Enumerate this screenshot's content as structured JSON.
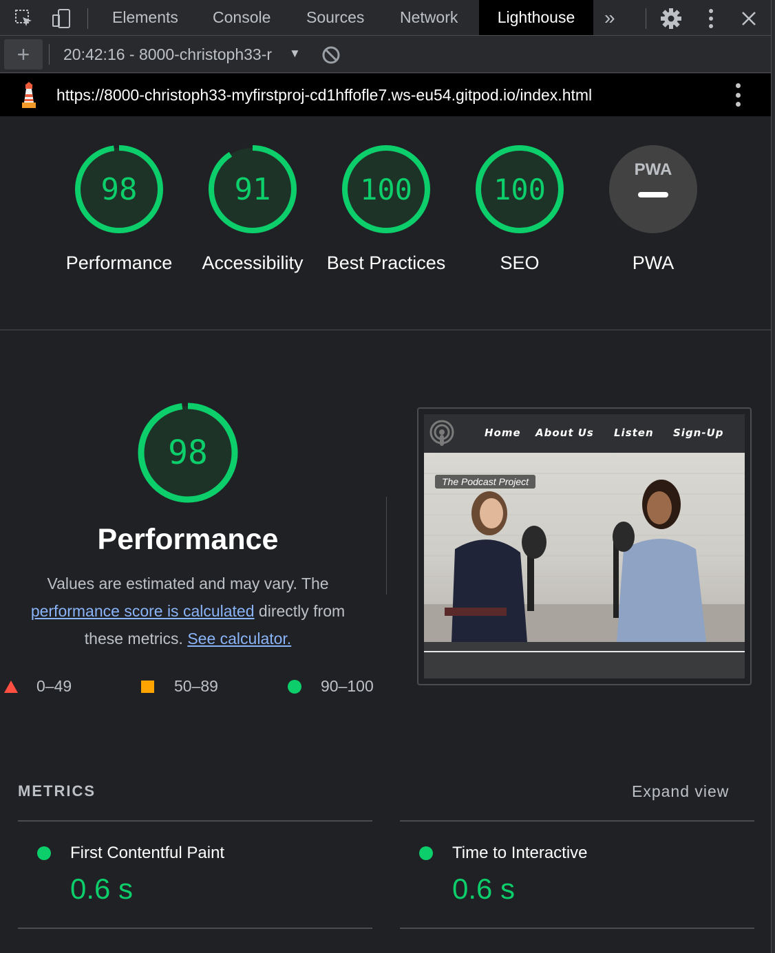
{
  "devtools": {
    "tabs": [
      "Elements",
      "Console",
      "Sources",
      "Network",
      "Lighthouse"
    ],
    "active_tab": "Lighthouse",
    "more_tabs_glyph": "»"
  },
  "toolbar": {
    "add_glyph": "+",
    "report_label": "20:42:16 - 8000-christoph33-r",
    "caret_glyph": "▼"
  },
  "url_bar": {
    "url": "https://8000-christoph33-myfirstproj-cd1hffofle7.ws-eu54.gitpod.io/index.html"
  },
  "gauges": [
    {
      "score": "98",
      "label": "Performance",
      "value": 0.98
    },
    {
      "score": "91",
      "label": "Accessibility",
      "value": 0.91
    },
    {
      "score": "100",
      "label": "Best Practices",
      "value": 1.0
    },
    {
      "score": "100",
      "label": "SEO",
      "value": 1.0
    },
    {
      "score": "PWA",
      "label": "PWA",
      "value": null
    }
  ],
  "performance": {
    "score": "98",
    "value": 0.98,
    "title": "Performance",
    "desc_1": "Values are estimated and may vary. The ",
    "link_1": "performance score is calculated",
    "desc_2": " directly from these metrics. ",
    "link_2": "See calculator.",
    "legend": [
      {
        "range": "0–49",
        "color": "#ff4e42",
        "shape": "triangle"
      },
      {
        "range": "50–89",
        "color": "#ffa400",
        "shape": "square"
      },
      {
        "range": "90–100",
        "color": "#0cce6b",
        "shape": "circle"
      }
    ]
  },
  "screenshot": {
    "nav_items": [
      "Home",
      "About Us",
      "Listen",
      "Sign-Up"
    ],
    "hero_tag": "The Podcast Project"
  },
  "metrics": {
    "heading": "METRICS",
    "expand_label": "Expand view",
    "items": [
      {
        "name": "First Contentful Paint",
        "value": "0.6 s"
      },
      {
        "name": "Time to Interactive",
        "value": "0.6 s"
      }
    ]
  },
  "colors": {
    "pass": "#0cce6b",
    "pass_text": "#0cce6b",
    "gauge_bg": "#1e3327",
    "pwa_bg": "#424242",
    "link": "#8ab4f8"
  }
}
